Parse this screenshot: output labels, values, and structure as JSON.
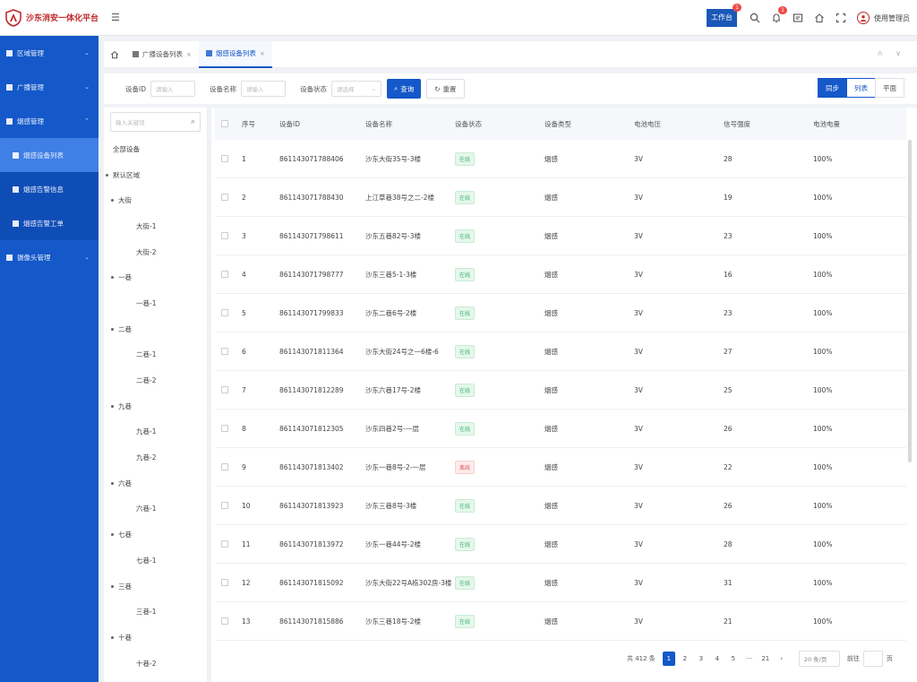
{
  "app": {
    "title": "沙东消安一体化平台",
    "menu_icon": "menu-toggle-icon"
  },
  "header": {
    "workbench_label": "工作台",
    "workbench_badge": "1",
    "notify_badge": "1",
    "user_name": "使用管理员"
  },
  "sidebar": {
    "items": [
      {
        "label": "区域管理",
        "expandable": true
      },
      {
        "label": "广播管理",
        "expandable": true
      },
      {
        "label": "烟感管理",
        "expandable": true
      }
    ],
    "sub_items": [
      {
        "label": "烟感设备列表",
        "active": true
      },
      {
        "label": "烟感告警信息",
        "active": false
      },
      {
        "label": "烟感告警工单",
        "active": false
      }
    ],
    "last_item": {
      "label": "摄像头管理",
      "expandable": true
    }
  },
  "tabs": [
    {
      "label": "广播设备列表",
      "active": false
    },
    {
      "label": "烟感设备列表",
      "active": true
    }
  ],
  "tabbar_right": "∩ ∨",
  "filters": {
    "device_id_label": "设备ID",
    "device_id_placeholder": "请输入",
    "device_name_label": "设备名称",
    "device_name_placeholder": "请输入",
    "device_status_label": "设备状态",
    "device_status_placeholder": "请选择",
    "search_label": "查询",
    "reset_label": "重置"
  },
  "view_switch": {
    "sync": "同步",
    "list": "列表",
    "plan": "平面"
  },
  "tree": {
    "search_placeholder": "输入关键词",
    "nodes": [
      {
        "label": "全部设备",
        "level": 0,
        "dot": false
      },
      {
        "label": "默认区域",
        "level": 0,
        "dot": true
      },
      {
        "label": "大街",
        "level": 1,
        "dot": true
      },
      {
        "label": "大街-1",
        "level": 2,
        "dot": false
      },
      {
        "label": "大街-2",
        "level": 2,
        "dot": false
      },
      {
        "label": "一巷",
        "level": 1,
        "dot": true
      },
      {
        "label": "一巷-1",
        "level": 2,
        "dot": false
      },
      {
        "label": "二巷",
        "level": 1,
        "dot": true
      },
      {
        "label": "二巷-1",
        "level": 2,
        "dot": false
      },
      {
        "label": "二巷-2",
        "level": 2,
        "dot": false
      },
      {
        "label": "九巷",
        "level": 1,
        "dot": true
      },
      {
        "label": "九巷-1",
        "level": 2,
        "dot": false
      },
      {
        "label": "九巷-2",
        "level": 2,
        "dot": false
      },
      {
        "label": "六巷",
        "level": 1,
        "dot": true
      },
      {
        "label": "六巷-1",
        "level": 2,
        "dot": false
      },
      {
        "label": "七巷",
        "level": 1,
        "dot": true
      },
      {
        "label": "七巷-1",
        "level": 2,
        "dot": false
      },
      {
        "label": "三巷",
        "level": 1,
        "dot": true
      },
      {
        "label": "三巷-1",
        "level": 2,
        "dot": false
      },
      {
        "label": "十巷",
        "level": 1,
        "dot": true
      },
      {
        "label": "十巷-2",
        "level": 2,
        "dot": false
      }
    ]
  },
  "table": {
    "columns": [
      "序号",
      "设备ID",
      "设备名称",
      "设备状态",
      "设备类型",
      "电池电压",
      "信号强度",
      "电池电量"
    ],
    "rows": [
      {
        "idx": "1",
        "id": "861143071788406",
        "name": "沙东大街35号-3楼",
        "status": "在线",
        "ok": true,
        "type": "烟感",
        "volt": "3V",
        "signal": "28",
        "batt": "100%"
      },
      {
        "idx": "2",
        "id": "861143071788430",
        "name": "上江草巷38号之二-2楼",
        "status": "在线",
        "ok": true,
        "type": "烟感",
        "volt": "3V",
        "signal": "19",
        "batt": "100%"
      },
      {
        "idx": "3",
        "id": "861143071798611",
        "name": "沙东五巷82号-3楼",
        "status": "在线",
        "ok": true,
        "type": "烟感",
        "volt": "3V",
        "signal": "23",
        "batt": "100%"
      },
      {
        "idx": "4",
        "id": "861143071798777",
        "name": "沙东三巷5-1-3楼",
        "status": "在线",
        "ok": true,
        "type": "烟感",
        "volt": "3V",
        "signal": "16",
        "batt": "100%"
      },
      {
        "idx": "5",
        "id": "861143071799833",
        "name": "沙东二巷6号-2楼",
        "status": "在线",
        "ok": true,
        "type": "烟感",
        "volt": "3V",
        "signal": "23",
        "batt": "100%"
      },
      {
        "idx": "6",
        "id": "861143071811364",
        "name": "沙东大街24号之一6楼-6",
        "status": "在线",
        "ok": true,
        "type": "烟感",
        "volt": "3V",
        "signal": "27",
        "batt": "100%"
      },
      {
        "idx": "7",
        "id": "861143071812289",
        "name": "沙东六巷17号-2楼",
        "status": "在线",
        "ok": true,
        "type": "烟感",
        "volt": "3V",
        "signal": "25",
        "batt": "100%"
      },
      {
        "idx": "8",
        "id": "861143071812305",
        "name": "沙东四巷2号-一层",
        "status": "在线",
        "ok": true,
        "type": "烟感",
        "volt": "3V",
        "signal": "26",
        "batt": "100%"
      },
      {
        "idx": "9",
        "id": "861143071813402",
        "name": "沙东一巷8号-2-一层",
        "status": "离线",
        "ok": false,
        "type": "烟感",
        "volt": "3V",
        "signal": "22",
        "batt": "100%"
      },
      {
        "idx": "10",
        "id": "861143071813923",
        "name": "沙东三巷8号-3楼",
        "status": "在线",
        "ok": true,
        "type": "烟感",
        "volt": "3V",
        "signal": "26",
        "batt": "100%"
      },
      {
        "idx": "11",
        "id": "861143071813972",
        "name": "沙东一巷44号-2楼",
        "status": "在线",
        "ok": true,
        "type": "烟感",
        "volt": "3V",
        "signal": "28",
        "batt": "100%"
      },
      {
        "idx": "12",
        "id": "861143071815092",
        "name": "沙东大街22号A栋302房-3楼",
        "status": "在线",
        "ok": true,
        "type": "烟感",
        "volt": "3V",
        "signal": "31",
        "batt": "100%"
      },
      {
        "idx": "13",
        "id": "861143071815886",
        "name": "沙东三巷18号-2楼",
        "status": "在线",
        "ok": true,
        "type": "烟感",
        "volt": "3V",
        "signal": "21",
        "batt": "100%"
      }
    ]
  },
  "pagination": {
    "total": "共 412 条",
    "pages": [
      "1",
      "2",
      "3",
      "4",
      "5",
      "···",
      "21"
    ],
    "current": "1",
    "page_size": "20 条/页",
    "goto_label": "前往",
    "page_unit": "页"
  }
}
